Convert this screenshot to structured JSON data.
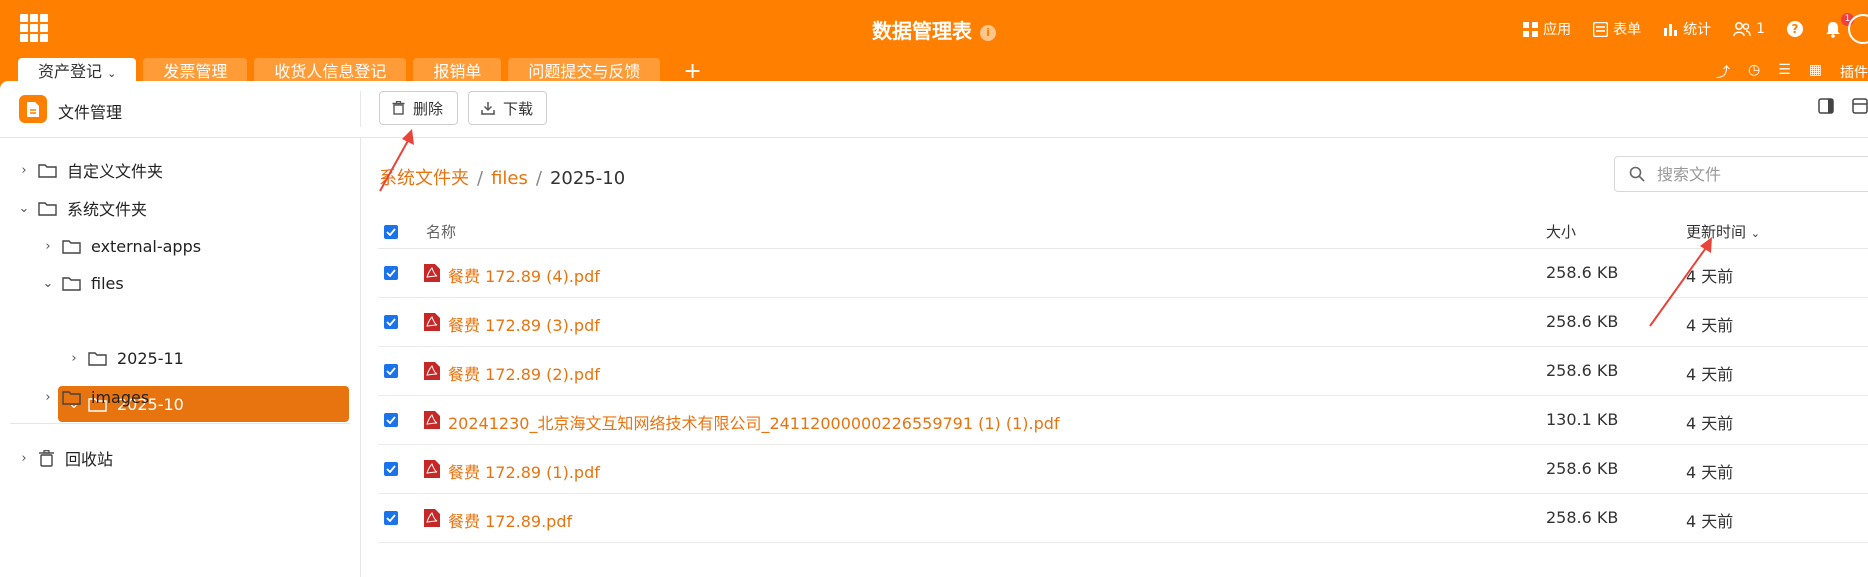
{
  "header": {
    "title": "数据管理表",
    "info_glyph": "i",
    "actions": [
      {
        "icon": "apps-icon",
        "label": "应用"
      },
      {
        "icon": "form-icon",
        "label": "表单"
      },
      {
        "icon": "stats-icon",
        "label": "统计"
      },
      {
        "icon": "members-icon",
        "label": "1"
      }
    ],
    "help_glyph": "?",
    "notification_count": "1"
  },
  "tabs": [
    {
      "label": "资产登记",
      "active": true
    },
    {
      "label": "发票管理"
    },
    {
      "label": "收货人信息登记"
    },
    {
      "label": "报销单"
    },
    {
      "label": "问题提交与反馈"
    }
  ],
  "tab_add": "+",
  "tab_tools_plugin": "插件",
  "file_manager": {
    "title": "文件管理",
    "delete_label": "删除",
    "download_label": "下载"
  },
  "sidebar": {
    "items": [
      {
        "label": "自定义文件夹",
        "expanded": false
      },
      {
        "label": "系统文件夹",
        "expanded": true
      },
      {
        "label": "external-apps",
        "expanded": false
      },
      {
        "label": "files",
        "expanded": true
      },
      {
        "label": "2025-10",
        "expanded": true,
        "selected": true
      },
      {
        "label": "2025-11",
        "expanded": false
      },
      {
        "label": "images",
        "expanded": false
      }
    ],
    "trash_label": "回收站"
  },
  "breadcrumb": [
    "系统文件夹",
    "files",
    "2025-10"
  ],
  "search": {
    "placeholder": "搜索文件"
  },
  "table": {
    "columns": {
      "name": "名称",
      "size": "大小",
      "time": "更新时间"
    },
    "rows": [
      {
        "name": "餐费 172.89 (4).pdf",
        "size": "258.6 KB",
        "time": "4 天前",
        "checked": true
      },
      {
        "name": "餐费 172.89 (3).pdf",
        "size": "258.6 KB",
        "time": "4 天前",
        "checked": true
      },
      {
        "name": "餐费 172.89 (2).pdf",
        "size": "258.6 KB",
        "time": "4 天前",
        "checked": true
      },
      {
        "name": "20241230_北京海文互知网络技术有限公司_24112000000226559791 (1) (1).pdf",
        "size": "130.1 KB",
        "time": "4 天前",
        "checked": true
      },
      {
        "name": "餐费 172.89 (1).pdf",
        "size": "258.6 KB",
        "time": "4 天前",
        "checked": true
      },
      {
        "name": "餐费 172.89.pdf",
        "size": "258.6 KB",
        "time": "4 天前",
        "checked": true
      }
    ]
  },
  "colors": {
    "brand": "#ff8000",
    "selected": "#e8740f",
    "checkbox": "#1a73e8",
    "arrow": "#e8443a"
  }
}
